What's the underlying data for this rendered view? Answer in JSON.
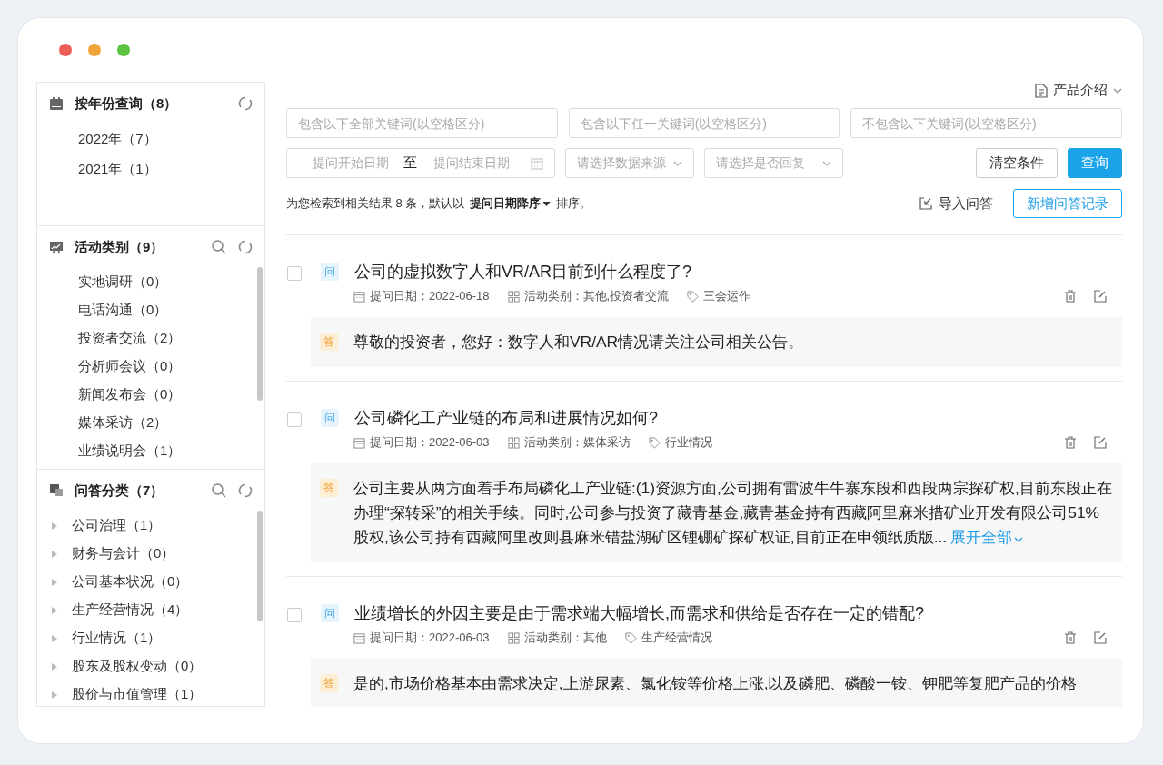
{
  "sidebar": {
    "sections": [
      {
        "kind": "year",
        "title": "按年份查询（8）",
        "search": false,
        "items": [
          {
            "label": "2022年（7）"
          },
          {
            "label": "2021年（1）"
          }
        ]
      },
      {
        "kind": "activity",
        "title": "活动类别（9）",
        "search": true,
        "items": [
          {
            "label": "实地调研（0）"
          },
          {
            "label": "电话沟通（0）"
          },
          {
            "label": "投资者交流（2）"
          },
          {
            "label": "分析师会议（0）"
          },
          {
            "label": "新闻发布会（0）"
          },
          {
            "label": "媒体采访（2）"
          },
          {
            "label": "业绩说明会（1）"
          }
        ]
      },
      {
        "kind": "qa",
        "title": "问答分类（7）",
        "search": true,
        "items": [
          {
            "label": "公司治理（1）",
            "expanded": false
          },
          {
            "label": "财务与会计（0）",
            "expanded": false
          },
          {
            "label": "公司基本状况（0）",
            "expanded": false
          },
          {
            "label": "生产经营情况（4）",
            "expanded": false
          },
          {
            "label": "行业情况（1）",
            "expanded": false
          },
          {
            "label": "股东及股权变动（0）",
            "expanded": false
          },
          {
            "label": "股价与市值管理（1）",
            "expanded": false
          }
        ]
      }
    ]
  },
  "top_menu": {
    "label": "产品介绍"
  },
  "filters": {
    "keywords": [
      {
        "placeholder": "包含以下全部关键词(以空格区分)"
      },
      {
        "placeholder": "包含以下任一关键词(以空格区分)"
      },
      {
        "placeholder": "不包含以下关键词(以空格区分)"
      }
    ],
    "date_start": {
      "placeholder": "提问开始日期"
    },
    "date_sep": "至",
    "date_end": {
      "placeholder": "提问结束日期"
    },
    "selects": [
      {
        "placeholder": "请选择数据来源"
      },
      {
        "placeholder": "请选择是否回复"
      }
    ],
    "clear_button": "清空条件",
    "query_button": "查询"
  },
  "summary": {
    "text": "为您检索到相关结果 8 条，默认以",
    "sort_label": "提问日期降序",
    "suffix": "排序。"
  },
  "import_button": "导入问答",
  "add_button": "新增问答记录",
  "questions": [
    {
      "checked": false,
      "q_mark": "问",
      "question": "公司的虚拟数字人和VR/AR目前到什么程度了?",
      "date": "提问日期：2022-06-18",
      "category": "活动类别：其他,投资者交流",
      "tag": "三会运作",
      "a_mark": "答",
      "answer": "尊敬的投资者，您好：数字人和VR/AR情况请关注公司相关公告。"
    },
    {
      "checked": false,
      "q_mark": "问",
      "question": "公司磷化工产业链的布局和进展情况如何?",
      "date": "提问日期：2022-06-03",
      "category": "活动类别：媒体采访",
      "tag": "行业情况",
      "a_mark": "答",
      "answer": "公司主要从两方面着手布局磷化工产业链:(1)资源方面,公司拥有雷波牛牛寨东段和西段两宗探矿权,目前东段正在办理“探转采”的相关手续。同时,公司参与投资了藏青基金,藏青基金持有西藏阿里麻米措矿业开发有限公司51%股权,该公司持有西藏阿里改则县麻米错盐湖矿区锂硼矿探矿权证,目前正在申领纸质版...",
      "expand_link": "展开全部"
    },
    {
      "checked": false,
      "q_mark": "问",
      "question": "业绩增长的外因主要是由于需求端大幅增长,而需求和供给是否存在一定的错配?",
      "date": "提问日期：2022-06-03",
      "category": "活动类别：其他",
      "tag": "生产经营情况",
      "a_mark": "答",
      "answer": "是的,市场价格基本由需求决定,上游尿素、氯化铵等价格上涨,以及磷肥、磷酸一铵、钾肥等复肥产品的价格"
    }
  ]
}
